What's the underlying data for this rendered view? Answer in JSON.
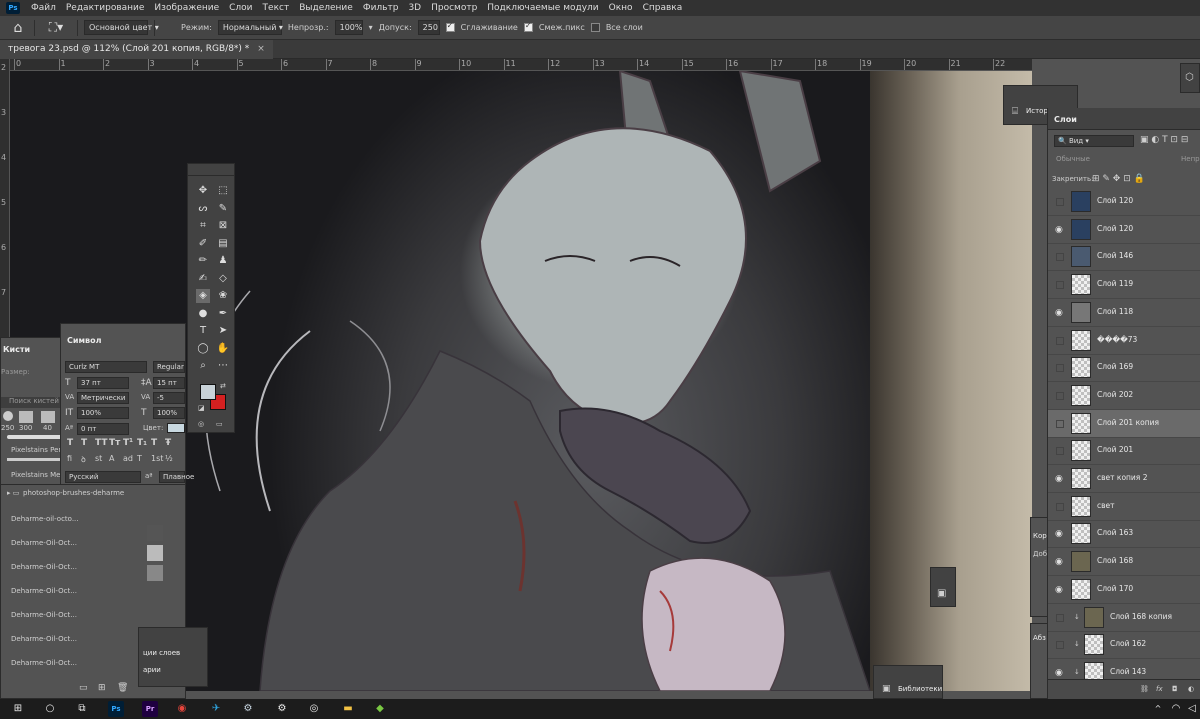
{
  "menu": {
    "logo": "Ps",
    "items": [
      "Файл",
      "Редактирование",
      "Изображение",
      "Слои",
      "Текст",
      "Выделение",
      "Фильтр",
      "3D",
      "Просмотр",
      "Подключаемые модули",
      "Окно",
      "Справка"
    ]
  },
  "options": {
    "fill_source": "Основной цвет",
    "mode_label": "Режим:",
    "mode_value": "Нормальный",
    "opacity_label": "Непрозр.:",
    "opacity_value": "100%",
    "tolerance_label": "Допуск:",
    "tolerance_value": "250",
    "antialias_label": "Сглаживание",
    "contiguous_label": "Смеж.пикс",
    "all_layers_label": "Все слои"
  },
  "document": {
    "tab_title": "тревога 23.psd @ 112% (Слой 201 копия, RGB/8*) *"
  },
  "rulers": {
    "top": [
      "0",
      "1",
      "2",
      "3",
      "4",
      "5",
      "6",
      "7",
      "8",
      "9",
      "10",
      "11",
      "12",
      "13",
      "14",
      "15",
      "16",
      "17",
      "18",
      "19",
      "20",
      "21",
      "22"
    ],
    "left": [
      "2",
      "3",
      "4",
      "5",
      "6",
      "7"
    ]
  },
  "brushes_panel": {
    "title": "Кисти",
    "size_label": "Размер:",
    "search_placeholder": "Поиск кистей",
    "sizes": [
      "250",
      "300",
      "40"
    ],
    "items": [
      "Pixelstains Penc...",
      "Pixelstains Mech..."
    ],
    "folder": "photoshop-brushes-deharme",
    "oil_items": [
      "Deharme-oil-octo...",
      "Deharme-Oil-Oct...",
      "Deharme-Oil-Oct...",
      "Deharme-Oil-Oct...",
      "Deharme-Oil-Oct...",
      "Deharme-Oil-Oct...",
      "Deharme-Oil-Oct..."
    ]
  },
  "character_panel": {
    "title": "Символ",
    "font": "Curlz MT",
    "style": "Regular",
    "size": "37 пт",
    "leading": "15 пт",
    "kerning": "Метрически",
    "tracking": "-5",
    "vscale": "100%",
    "hscale": "100%",
    "baseline": "0 пт",
    "color_label": "Цвет:",
    "language": "Русский",
    "aa_label": "aª",
    "antialias": "Плавное"
  },
  "history_tab": "Истор",
  "layers_panel": {
    "tab": "Слои",
    "filter": "Вид",
    "blend": "Обычные",
    "opacity_short": "Непро",
    "lock_label": "Закрепить:",
    "layers": [
      {
        "name": "Слой 120",
        "visible": false,
        "thumb": "#2a4060"
      },
      {
        "name": "Слой 120",
        "visible": true,
        "thumb": "#2a4060"
      },
      {
        "name": "Слой 146",
        "visible": false,
        "thumb": "#4a5a70"
      },
      {
        "name": "Слой 119",
        "visible": false,
        "thumb": ""
      },
      {
        "name": "Слой 118",
        "visible": true,
        "thumb": "#777777"
      },
      {
        "name": "����73",
        "visible": false,
        "thumb": ""
      },
      {
        "name": "Слой 169",
        "visible": false,
        "thumb": ""
      },
      {
        "name": "Слой 202",
        "visible": false,
        "thumb": ""
      },
      {
        "name": "Слой 201 копия",
        "visible": false,
        "thumb": "",
        "selected": true
      },
      {
        "name": "Слой 201",
        "visible": false,
        "thumb": ""
      },
      {
        "name": "свет копия 2",
        "visible": true,
        "thumb": ""
      },
      {
        "name": "свет",
        "visible": false,
        "thumb": ""
      },
      {
        "name": "Слой 163",
        "visible": true,
        "thumb": ""
      },
      {
        "name": "Слой 168",
        "visible": true,
        "thumb": "#6b6650"
      },
      {
        "name": "Слой 170",
        "visible": true,
        "thumb": ""
      },
      {
        "name": "Слой 168 копия",
        "visible": false,
        "thumb": "#6b6650"
      },
      {
        "name": "Слой 162",
        "visible": false,
        "thumb": ""
      },
      {
        "name": "Слой 143",
        "visible": true,
        "thumb": ""
      }
    ]
  },
  "right_edge_tabs": {
    "corr": "Кор",
    "add": "Доб",
    "abs": "Абз"
  },
  "bottom_panels": {
    "comps": "ции слоев",
    "art": "арии",
    "libraries": "Библиотеки"
  },
  "colors": {
    "foreground": "#c8d2d8",
    "background": "#d42020"
  }
}
